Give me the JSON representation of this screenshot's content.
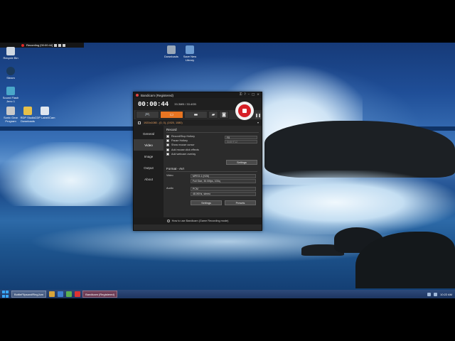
{
  "recording_overlay": {
    "text": "Recording [00:00:44]"
  },
  "desktop_icons": [
    {
      "label": "Recycle Bin",
      "icon": "recycle-bin-icon",
      "color": "#cfd8e2"
    },
    {
      "label": "Steam",
      "icon": "steam-icon",
      "color": "#1b3a5c"
    },
    {
      "label": "Sound Flash Jeno 1",
      "icon": "sound-flash-icon",
      "color": "#4aa7c9"
    },
    {
      "label": "Sonic Gear Program",
      "icon": "gear-program-icon",
      "color": "#c9c9c9"
    },
    {
      "label": "RDP Studio Downloads",
      "icon": "folder-icon",
      "color": "#e6c04a"
    },
    {
      "label": "CDP Label/Cam",
      "icon": "document-icon",
      "color": "#dfe6ef"
    },
    {
      "label": "Downloads",
      "icon": "downloads-icon",
      "color": "#9aa8b8"
    },
    {
      "label": "Save New Library",
      "icon": "library-icon",
      "color": "#6c9bd1"
    }
  ],
  "bandicam": {
    "title": "Bandicam (Registered)",
    "timer": "00:00:44",
    "file_size": "33.3MB / 33.4GB",
    "resolution_line": "1920x1080 - (0, 0), (1920, 1080)",
    "sidebar": [
      "General",
      "Video",
      "Image",
      "Output",
      "About"
    ],
    "active_tab": "Video",
    "record_section": "Record",
    "options": [
      {
        "label": "Record/Stop Hotkey",
        "checked": true,
        "hotkey": "F8"
      },
      {
        "label": "Pause Hotkey",
        "checked": false,
        "hotkey": "Shift+F12"
      },
      {
        "label": "Show mouse cursor",
        "checked": true
      },
      {
        "label": "Add mouse click effects",
        "checked": false
      },
      {
        "label": "Add webcam overlay",
        "checked": false
      }
    ],
    "settings_button": "Settings",
    "format_section": "Format - AVI",
    "video_label": "Video",
    "video_codec": "MPEG-1 (H26)",
    "video_settings": "Full Size, 30.00fps, 100q",
    "audio_label": "Audio",
    "audio_codec": "PCM",
    "audio_settings": "48.0KHz, stereo",
    "format_settings_button": "Settings",
    "presets_button": "Presets",
    "footer_text": "How to use Bandicam (Game Recording mode)"
  },
  "taskbar": {
    "items": [
      {
        "label": "BottleFlipsandRingJum"
      },
      {
        "label": "Bandicam (Registered)"
      }
    ],
    "clock": "10:22 AM",
    "accent": "#39a7ff"
  },
  "colors": {
    "record_red": "#d61f26",
    "active_mode": "#e87522"
  }
}
